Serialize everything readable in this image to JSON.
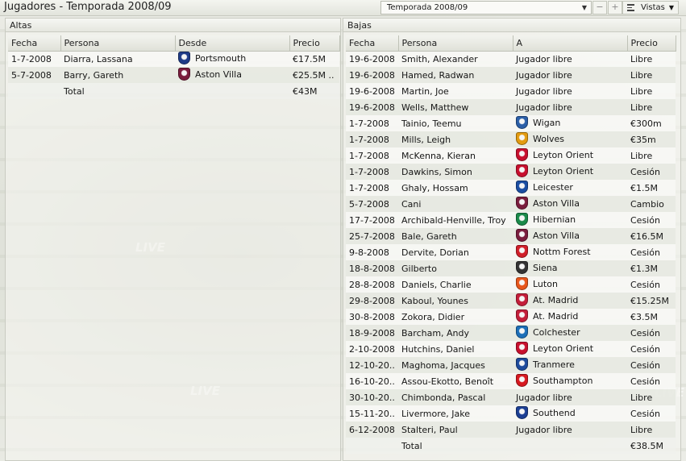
{
  "window": {
    "title": "Jugadores - Temporada 2008/09"
  },
  "toolbar": {
    "season_selected": "Temporada 2008/09",
    "minus_label": "−",
    "plus_label": "+",
    "views_label": "Vistas"
  },
  "incoming": {
    "title": "Altas",
    "columns": [
      "Fecha",
      "Persona",
      "Desde",
      "Precio"
    ],
    "rows": [
      {
        "date": "1-7-2008",
        "person": "Diarra, Lassana",
        "club": "Portsmouth",
        "fee": "€17.5M",
        "crest": "#1f3c88"
      },
      {
        "date": "5-7-2008",
        "person": "Barry, Gareth",
        "club": "Aston Villa",
        "fee": "€25.5M ..",
        "crest": "#7a1d3d"
      }
    ],
    "total_label": "Total",
    "total_value": "€43M"
  },
  "outgoing": {
    "title": "Bajas",
    "columns": [
      "Fecha",
      "Persona",
      "A",
      "Precio"
    ],
    "rows": [
      {
        "date": "19-6-2008",
        "person": "Smith, Alexander",
        "club": "Jugador libre",
        "fee": "Libre",
        "crest": ""
      },
      {
        "date": "19-6-2008",
        "person": "Hamed, Radwan",
        "club": "Jugador libre",
        "fee": "Libre",
        "crest": ""
      },
      {
        "date": "19-6-2008",
        "person": "Martin, Joe",
        "club": "Jugador libre",
        "fee": "Libre",
        "crest": ""
      },
      {
        "date": "19-6-2008",
        "person": "Wells, Matthew",
        "club": "Jugador libre",
        "fee": "Libre",
        "crest": ""
      },
      {
        "date": "1-7-2008",
        "person": "Tainio, Teemu",
        "club": "Wigan",
        "fee": "€300m",
        "crest": "#2b5fa8"
      },
      {
        "date": "1-7-2008",
        "person": "Mills, Leigh",
        "club": "Wolves",
        "fee": "€35m",
        "crest": "#e39b10"
      },
      {
        "date": "1-7-2008",
        "person": "McKenna, Kieran",
        "club": "Leyton Orient",
        "fee": "Libre",
        "crest": "#c8102e"
      },
      {
        "date": "1-7-2008",
        "person": "Dawkins, Simon",
        "club": "Leyton Orient",
        "fee": "Cesión",
        "crest": "#c8102e"
      },
      {
        "date": "1-7-2008",
        "person": "Ghaly, Hossam",
        "club": "Leicester",
        "fee": "€1.5M",
        "crest": "#1b4ea3"
      },
      {
        "date": "5-7-2008",
        "person": "Cani",
        "club": "Aston Villa",
        "fee": "Cambio",
        "crest": "#7a1d3d"
      },
      {
        "date": "17-7-2008",
        "person": "Archibald-Henville, Troy",
        "club": "Hibernian",
        "fee": "Cesión",
        "crest": "#1b8a4a"
      },
      {
        "date": "25-7-2008",
        "person": "Bale, Gareth",
        "club": "Aston Villa",
        "fee": "€16.5M",
        "crest": "#7a1d3d"
      },
      {
        "date": "9-8-2008",
        "person": "Dervite, Dorian",
        "club": "Nottm Forest",
        "fee": "Cesión",
        "crest": "#d11f2a"
      },
      {
        "date": "18-8-2008",
        "person": "Gilberto",
        "club": "Siena",
        "fee": "€1.3M",
        "crest": "#333333"
      },
      {
        "date": "28-8-2008",
        "person": "Daniels, Charlie",
        "club": "Luton",
        "fee": "Cesión",
        "crest": "#e8561b"
      },
      {
        "date": "29-8-2008",
        "person": "Kaboul, Younes",
        "club": "At. Madrid",
        "fee": "€15.25M",
        "crest": "#c41e3a"
      },
      {
        "date": "30-8-2008",
        "person": "Zokora, Didier",
        "club": "At. Madrid",
        "fee": "€3.5M",
        "crest": "#c41e3a"
      },
      {
        "date": "18-9-2008",
        "person": "Barcham, Andy",
        "club": "Colchester",
        "fee": "Cesión",
        "crest": "#1d6fb8"
      },
      {
        "date": "2-10-2008",
        "person": "Hutchins, Daniel",
        "club": "Leyton Orient",
        "fee": "Cesión",
        "crest": "#c8102e"
      },
      {
        "date": "12-10-20..",
        "person": "Maghoma, Jacques",
        "club": "Tranmere",
        "fee": "Cesión",
        "crest": "#1e4b9c"
      },
      {
        "date": "16-10-20..",
        "person": "Assou-Ekotto, Benoît",
        "club": "Southampton",
        "fee": "Cesión",
        "crest": "#d71920"
      },
      {
        "date": "30-10-20..",
        "person": "Chimbonda, Pascal",
        "club": "Jugador libre",
        "fee": "Libre",
        "crest": ""
      },
      {
        "date": "15-11-20..",
        "person": "Livermore, Jake",
        "club": "Southend",
        "fee": "Cesión",
        "crest": "#1c3f94"
      },
      {
        "date": "6-12-2008",
        "person": "Stalteri, Paul",
        "club": "Jugador libre",
        "fee": "Libre",
        "crest": ""
      }
    ],
    "total_label": "Total",
    "total_value": "€38.5M"
  }
}
